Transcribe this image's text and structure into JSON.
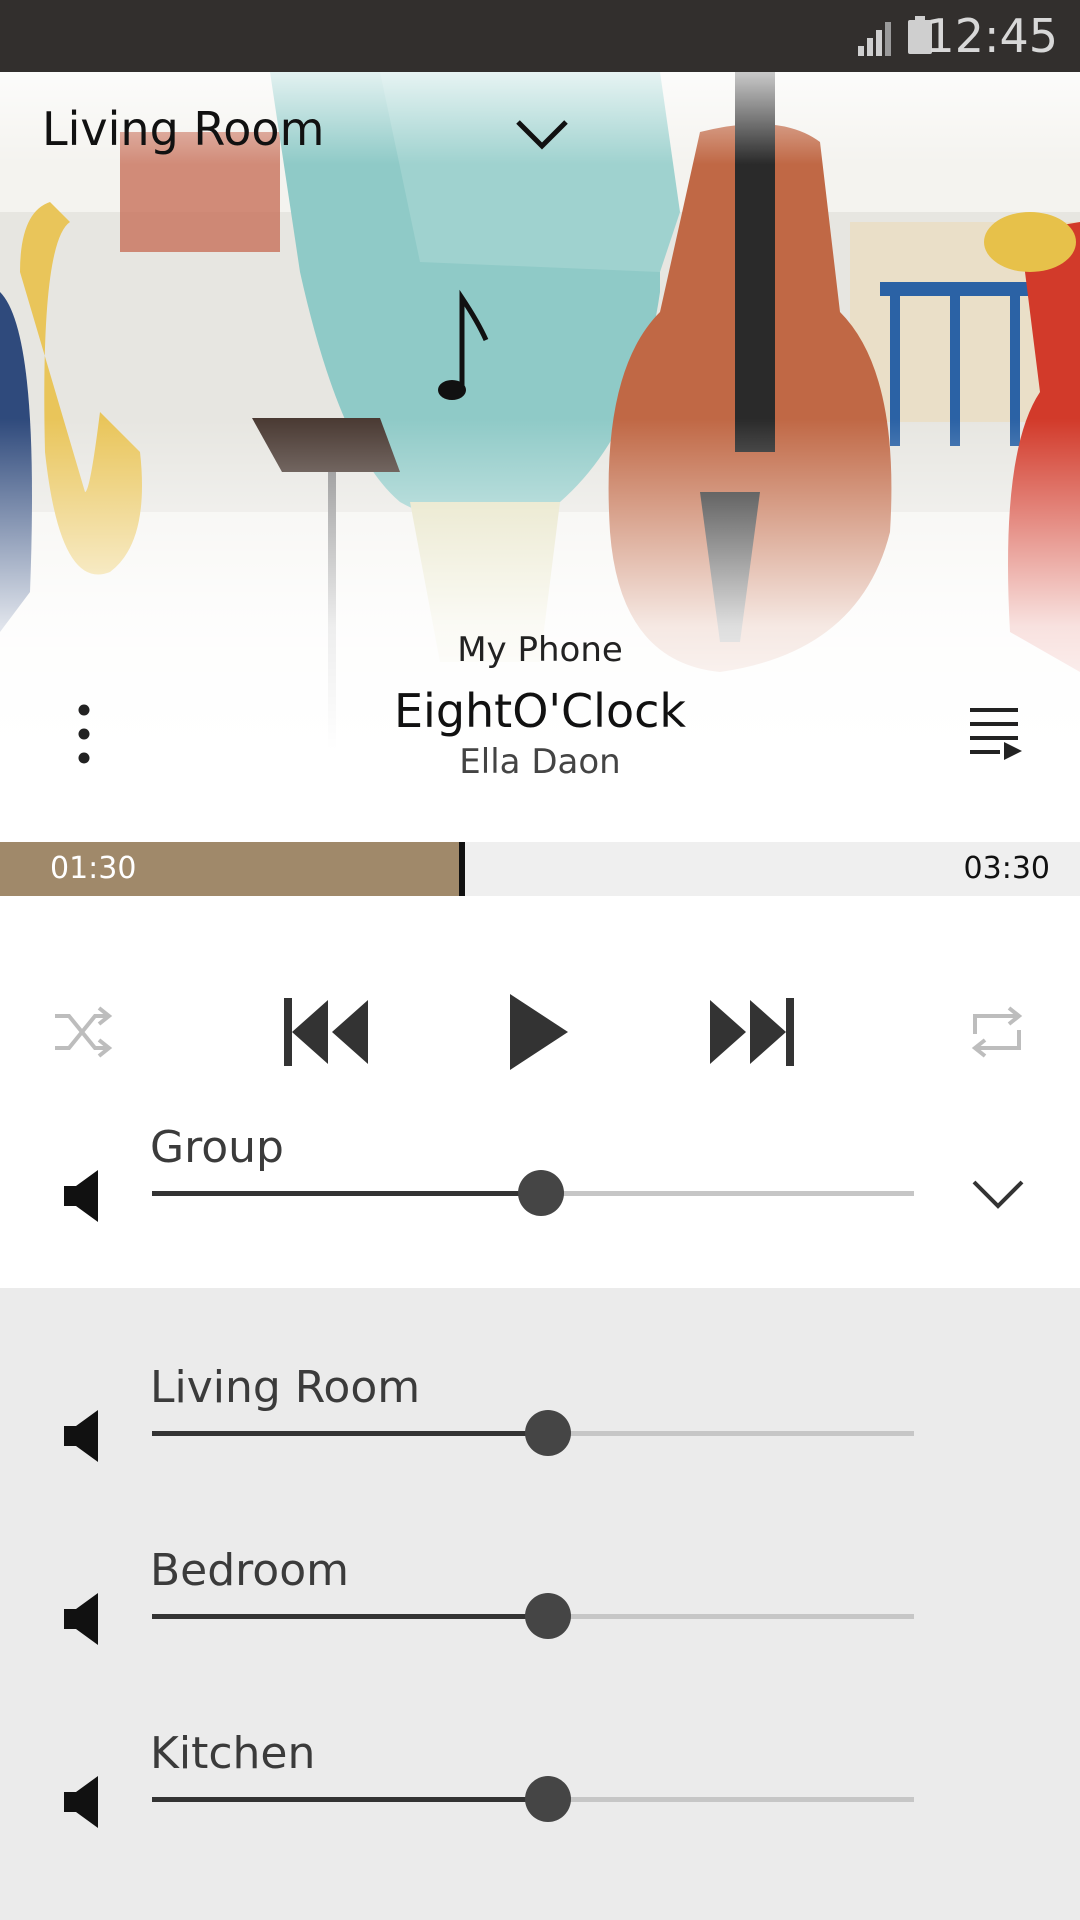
{
  "status_bar": {
    "time": "12:45"
  },
  "header": {
    "room": "Living Room"
  },
  "now_playing": {
    "source": "My Phone",
    "title": "EightO'Clock",
    "artist": "Ella Daon",
    "elapsed": "01:30",
    "duration": "03:30",
    "progress": 0.428
  },
  "controls": {
    "shuffle": "shuffle-icon",
    "previous": "previous-icon",
    "play": "play-icon",
    "next": "next-icon",
    "repeat": "repeat-icon"
  },
  "group": {
    "label": "Group",
    "volume": 0.51
  },
  "speakers": [
    {
      "label": "Living Room",
      "volume": 0.52
    },
    {
      "label": "Bedroom",
      "volume": 0.52
    },
    {
      "label": "Kitchen",
      "volume": 0.52
    }
  ],
  "colors": {
    "accent": "#a0896a",
    "statusbar": "#322f2d",
    "panel": "#ebebeb"
  }
}
